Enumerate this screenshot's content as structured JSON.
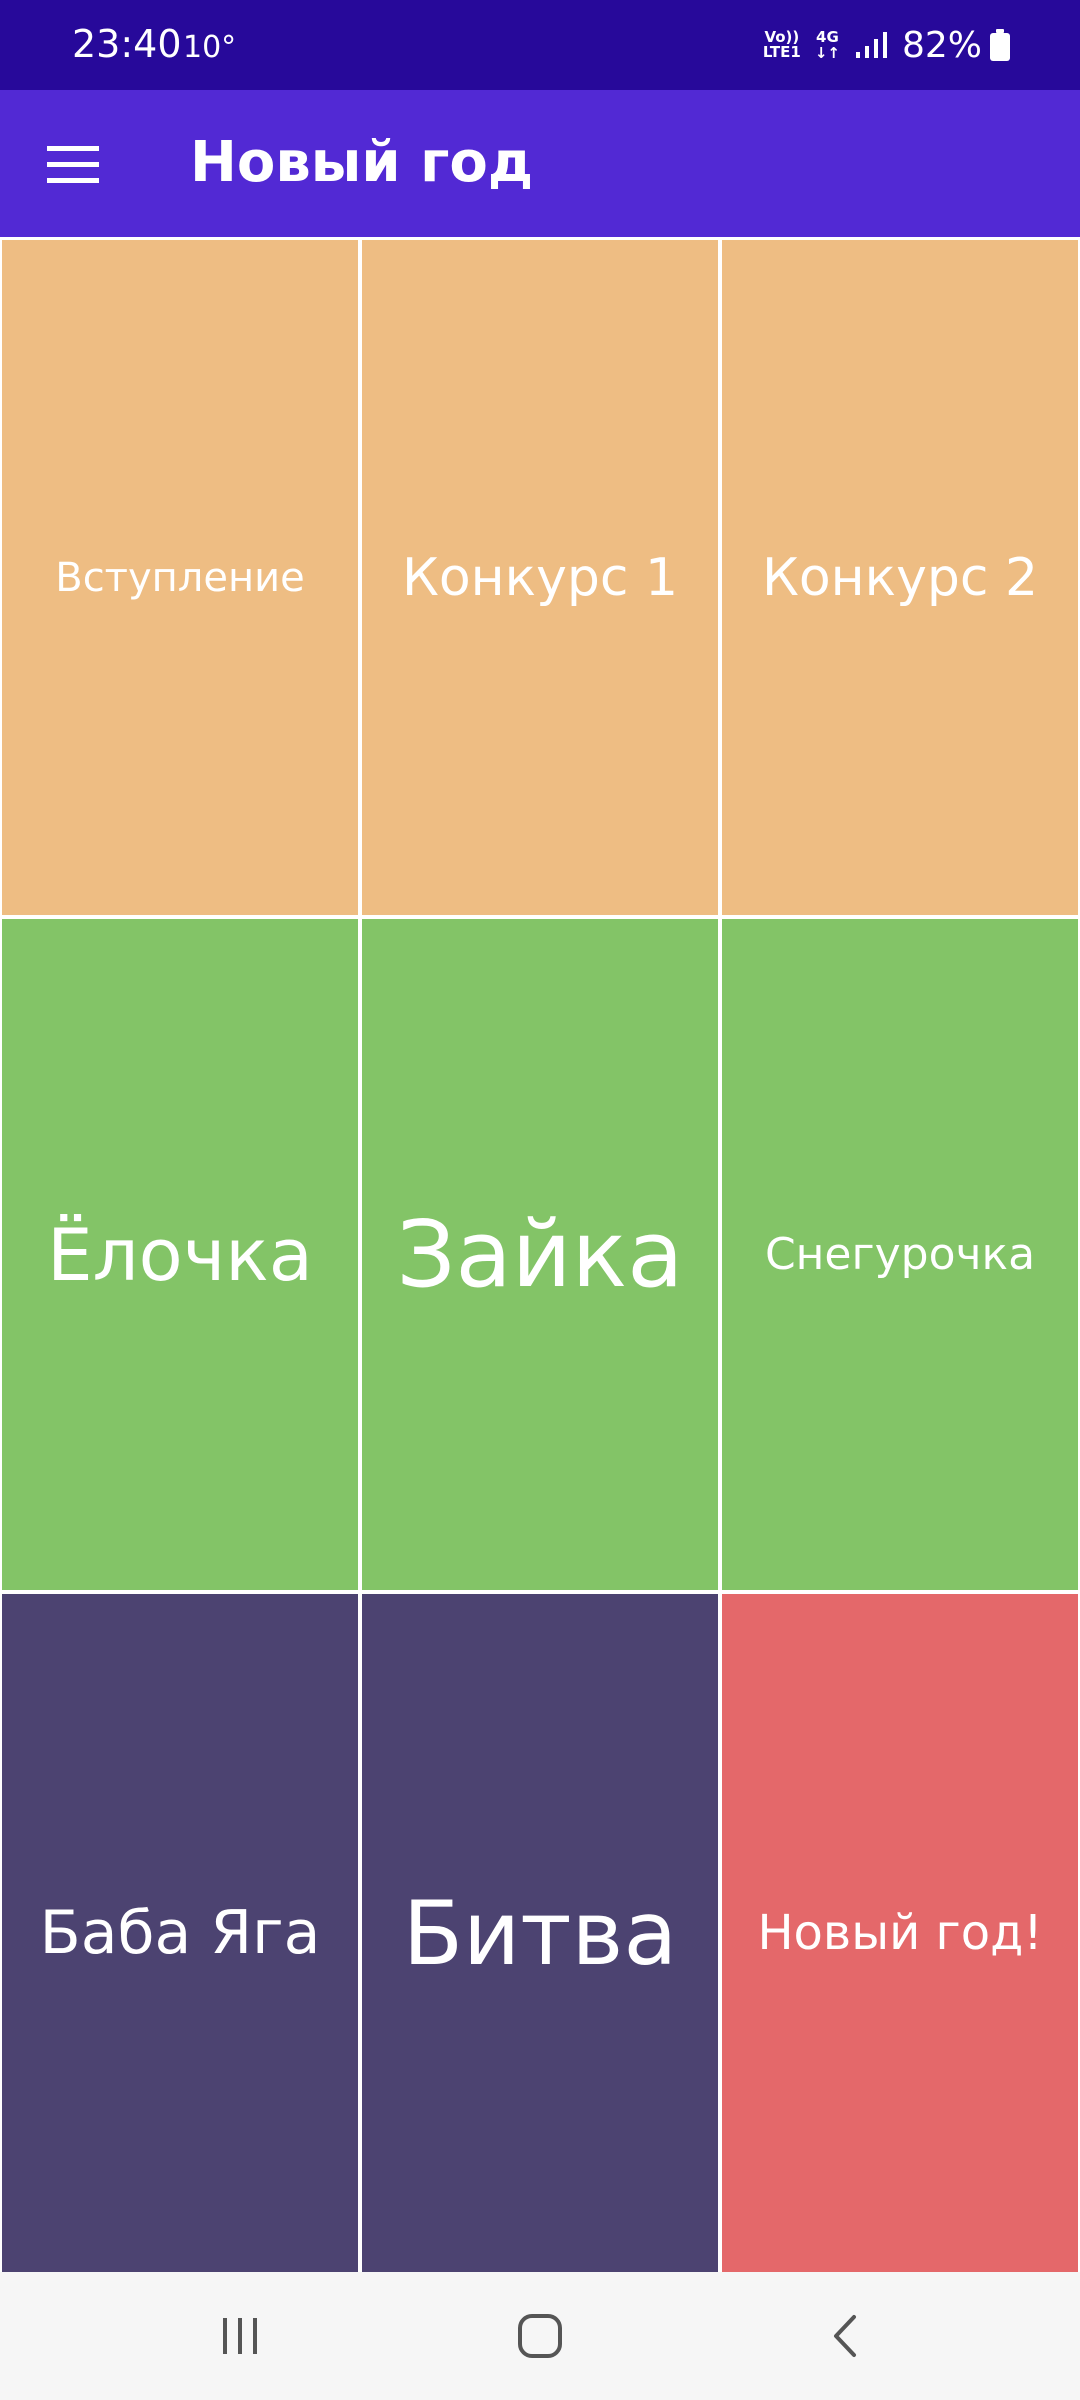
{
  "status_bar": {
    "time": "23:40",
    "temperature": "10°",
    "volte_top": "Vo))",
    "volte_bottom": "LTE1",
    "network_type": "4G",
    "network_arrows": "↓↑",
    "battery_percent": "82%",
    "signal_icon": "signal-bars-icon",
    "battery_icon": "battery-icon"
  },
  "app_bar": {
    "menu_icon": "hamburger-menu-icon",
    "title": "Новый год"
  },
  "grid": {
    "rows": [
      [
        {
          "label": "Вступление",
          "color": "#eebd83"
        },
        {
          "label": "Конкурс 1",
          "color": "#eebd83"
        },
        {
          "label": "Конкурс 2",
          "color": "#eebd83"
        }
      ],
      [
        {
          "label": "Ёлочка",
          "color": "#83c467"
        },
        {
          "label": "Зайка",
          "color": "#83c467"
        },
        {
          "label": "Снегурочка",
          "color": "#83c467"
        }
      ],
      [
        {
          "label": "Баба Яга",
          "color": "#4c4371"
        },
        {
          "label": "Битва",
          "color": "#4c4371"
        },
        {
          "label": "Новый год!",
          "color": "#e4686a"
        }
      ]
    ]
  },
  "nav_bar": {
    "recents_icon": "recent-apps-icon",
    "home_icon": "home-icon",
    "back_icon": "back-icon"
  },
  "colors": {
    "status_bar": "#27099a",
    "app_bar": "#5229d4",
    "nav_bar": "#f6f6f6"
  }
}
